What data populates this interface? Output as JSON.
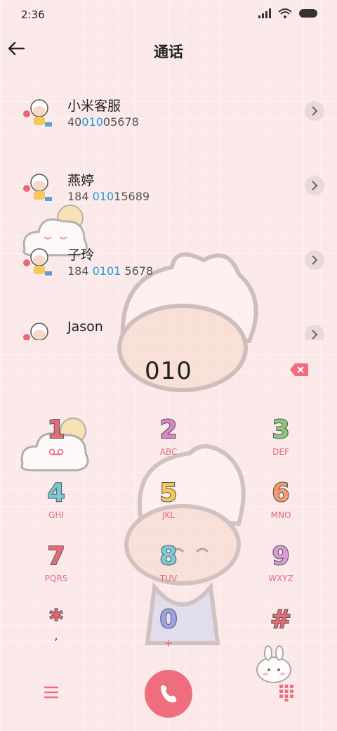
{
  "status": {
    "time": "2:36",
    "signal_icon": "signal-icon",
    "wifi_icon": "wifi-icon",
    "battery_icon": "battery-icon"
  },
  "header": {
    "title": "通话",
    "back_icon": "back-arrow-icon"
  },
  "contacts": [
    {
      "name": "小米客服",
      "num_pre": "40",
      "num_hl": "010",
      "num_post": "05678"
    },
    {
      "name": "燕婷",
      "num_pre": "184 ",
      "num_hl": "010",
      "num_post": "15689"
    },
    {
      "name": "子玲",
      "num_pre": "184 ",
      "num_hl": "0101",
      "num_post": " 5678"
    },
    {
      "name": "Jason",
      "num_pre": "",
      "num_hl": "",
      "num_post": ""
    }
  ],
  "dialer": {
    "number": "010"
  },
  "keys": [
    {
      "digit": "1",
      "letters": "",
      "color": "#e86b74"
    },
    {
      "digit": "2",
      "letters": "ABC",
      "color": "#d883c8"
    },
    {
      "digit": "3",
      "letters": "DEF",
      "color": "#8cc67a"
    },
    {
      "digit": "4",
      "letters": "GHI",
      "color": "#76c9d6"
    },
    {
      "digit": "5",
      "letters": "JKL",
      "color": "#f4c95a"
    },
    {
      "digit": "6",
      "letters": "MNO",
      "color": "#f39a6a"
    },
    {
      "digit": "7",
      "letters": "PQRS",
      "color": "#e86b74"
    },
    {
      "digit": "8",
      "letters": "TUV",
      "color": "#7cc9dc"
    },
    {
      "digit": "9",
      "letters": "WXYZ",
      "color": "#d79ad6"
    },
    {
      "digit": "*",
      "letters": ",",
      "color": "#e86b74"
    },
    {
      "digit": "0",
      "letters": "+",
      "color": "#9aa3e8"
    },
    {
      "digit": "#",
      "letters": "",
      "color": "#e86b74"
    }
  ],
  "colors": {
    "accent": "#ee6e7e",
    "highlight": "#1d9bd7",
    "background": "#fbe9ea"
  },
  "bottom": {
    "menu_icon": "menu-icon",
    "call_icon": "phone-icon",
    "keypad_icon": "keypad-icon"
  }
}
